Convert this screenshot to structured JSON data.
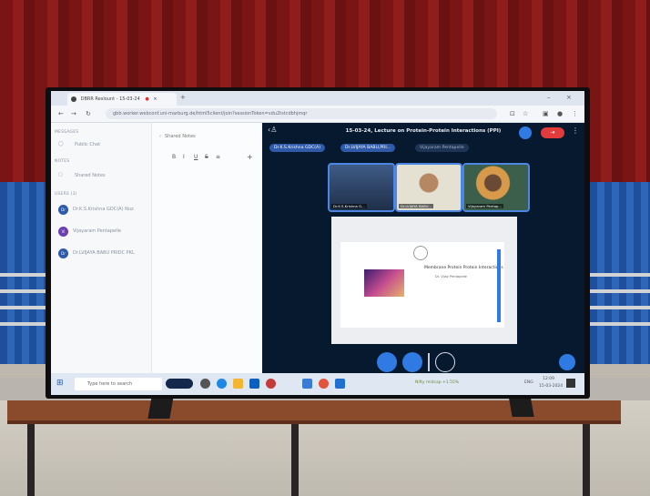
{
  "browser": {
    "tab_title": "DBRR Reslount - 15-03-24",
    "url": "gbb.worker.webconf.uni-marburg.de/html5client/join?sessionToken=vdu2tstcdbhjmqr"
  },
  "sidebar": {
    "messages_label": "MESSAGES",
    "public_chat": "Public Chat",
    "notes_label": "NOTES",
    "shared_notes": "Shared Notes",
    "users_label": "USERS (3)",
    "users": [
      {
        "initials": "Dr",
        "name": "Dr.K.S.Krishna GDC(A) Nuz"
      },
      {
        "initials": "Vi",
        "name": "Vijayaram Pentapelle"
      },
      {
        "initials": "Dr",
        "name": "Dr.LVIJAYA BABU PRIDC PKL"
      }
    ]
  },
  "notes_panel": {
    "header": "Shared Notes",
    "toolbar": [
      "B",
      "I",
      "U",
      "S",
      "≡",
      "+"
    ]
  },
  "meeting": {
    "title": "15-03-24, Lecture on Protein-Protein Interactions (PPI)",
    "presenter_chips": [
      "Dr.K.S.Krishna GDC(A)",
      "Dr.LVIJAYA BABU,PRI...",
      "Vijayaram Pentapelle"
    ],
    "cameras": [
      {
        "name": "Dr.K.S.Krishna G..."
      },
      {
        "name": "Dr.LVIJAYA BABU..."
      },
      {
        "name": "Vijayaram Pentap..."
      }
    ],
    "slide_title": "Membrane Protein Protein Interactions",
    "slide_subtitle": "Dr. Vijay Pentapelle"
  },
  "taskbar": {
    "search_placeholder": "Type here to search",
    "tray_text": "Nifty midcap +1.55%",
    "time": "12:09",
    "date": "15-03-2024",
    "lang": "ENG"
  },
  "colors": {
    "curtain": "#7a1515",
    "accent": "#2f7be3",
    "leave": "#e23b3b",
    "meeting_bg": "#06192e"
  }
}
